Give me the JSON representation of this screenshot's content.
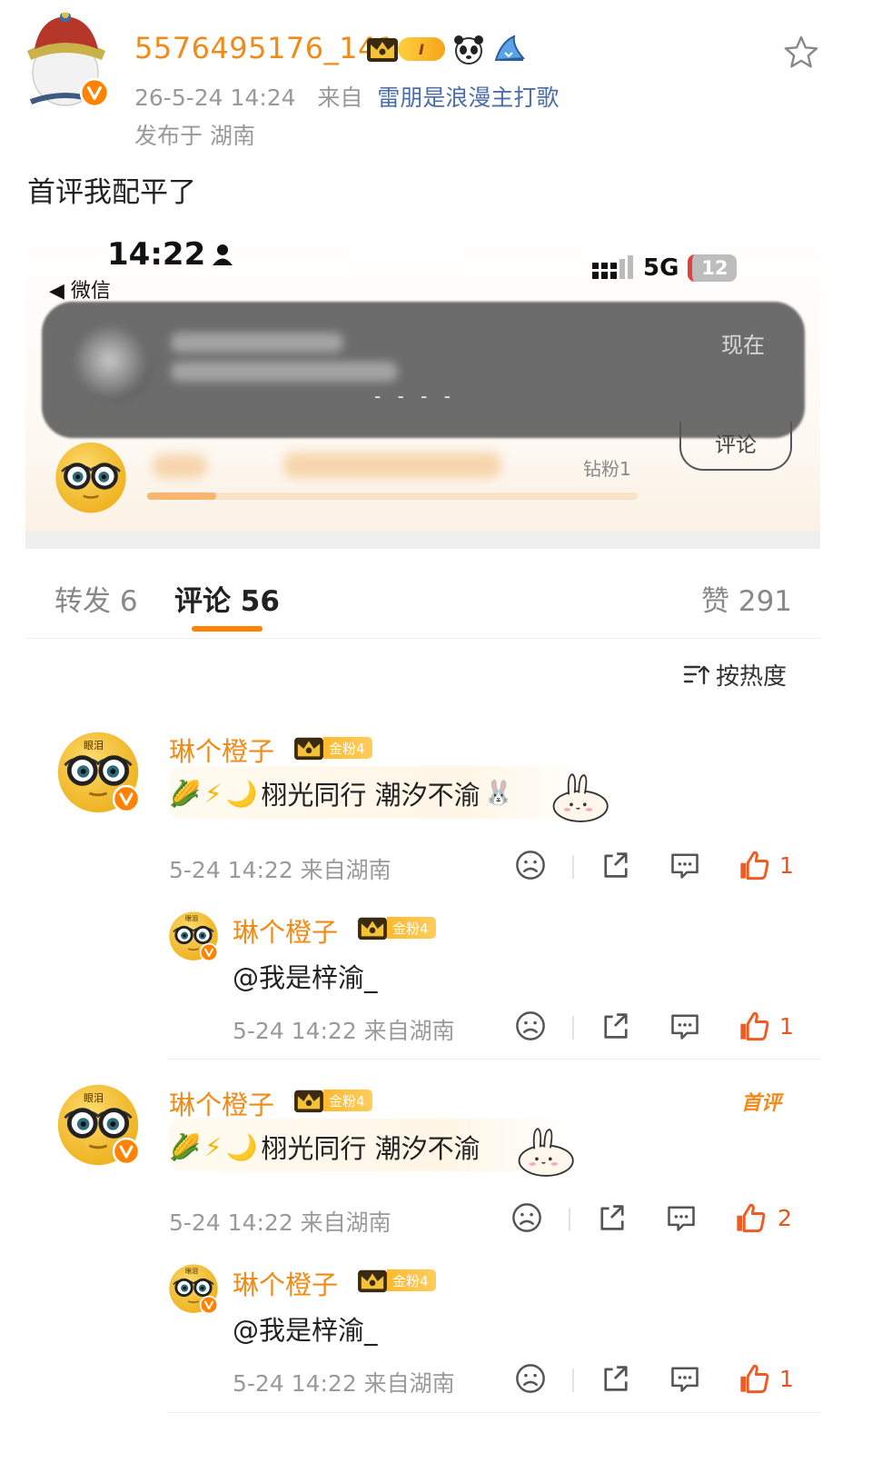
{
  "post": {
    "username": "5576495176_141",
    "level_badge": "I",
    "meta_time": "26-5-24 14:24",
    "meta_from_prefix": "来自",
    "meta_source": "雷朋是浪漫主打歌",
    "location": "发布于 湖南",
    "text": "首评我配平了",
    "icons": [
      "crown-icon",
      "panda-icon",
      "shark-icon",
      "star-icon"
    ]
  },
  "screenshot": {
    "time": "14:22",
    "back_label": "◀ 微信",
    "network": "5G",
    "battery": "12",
    "notification_time": "现在",
    "notification_dash": "- - - -",
    "fans_label": "钻粉1",
    "comment_button": "评论",
    "progress": 0.14
  },
  "tabs": {
    "repost": "转发 6",
    "comment": "评论 56",
    "like": "赞 291",
    "sort": "按热度"
  },
  "comments": [
    {
      "name": "琳个橙子",
      "fan_badge": "金粉4",
      "text": "栩光同行 潮汐不渝",
      "avatar_label": "眼泪",
      "meta": "5-24 14:22 来自湖南",
      "likes": "1",
      "reply": {
        "name": "琳个橙子",
        "fan_badge": "金粉4",
        "text": "@我是梓渝_",
        "avatar_label": "眼泪",
        "meta": "5-24 14:22 来自湖南",
        "likes": "1"
      }
    },
    {
      "name": "琳个橙子",
      "fan_badge": "金粉4",
      "text": "栩光同行 潮汐不渝",
      "avatar_label": "眼泪",
      "meta": "5-24 14:22 来自湖南",
      "likes": "2",
      "first_badge": "首评",
      "reply": {
        "name": "琳个橙子",
        "fan_badge": "金粉4",
        "text": "@我是梓渝_",
        "avatar_label": "眼泪",
        "meta": "5-24 14:22 来自湖南",
        "likes": "1"
      }
    }
  ],
  "colors": {
    "accent": "#ff8200",
    "username": "#f08a18",
    "source_link": "#4a6ea8",
    "like": "#e8541e"
  }
}
